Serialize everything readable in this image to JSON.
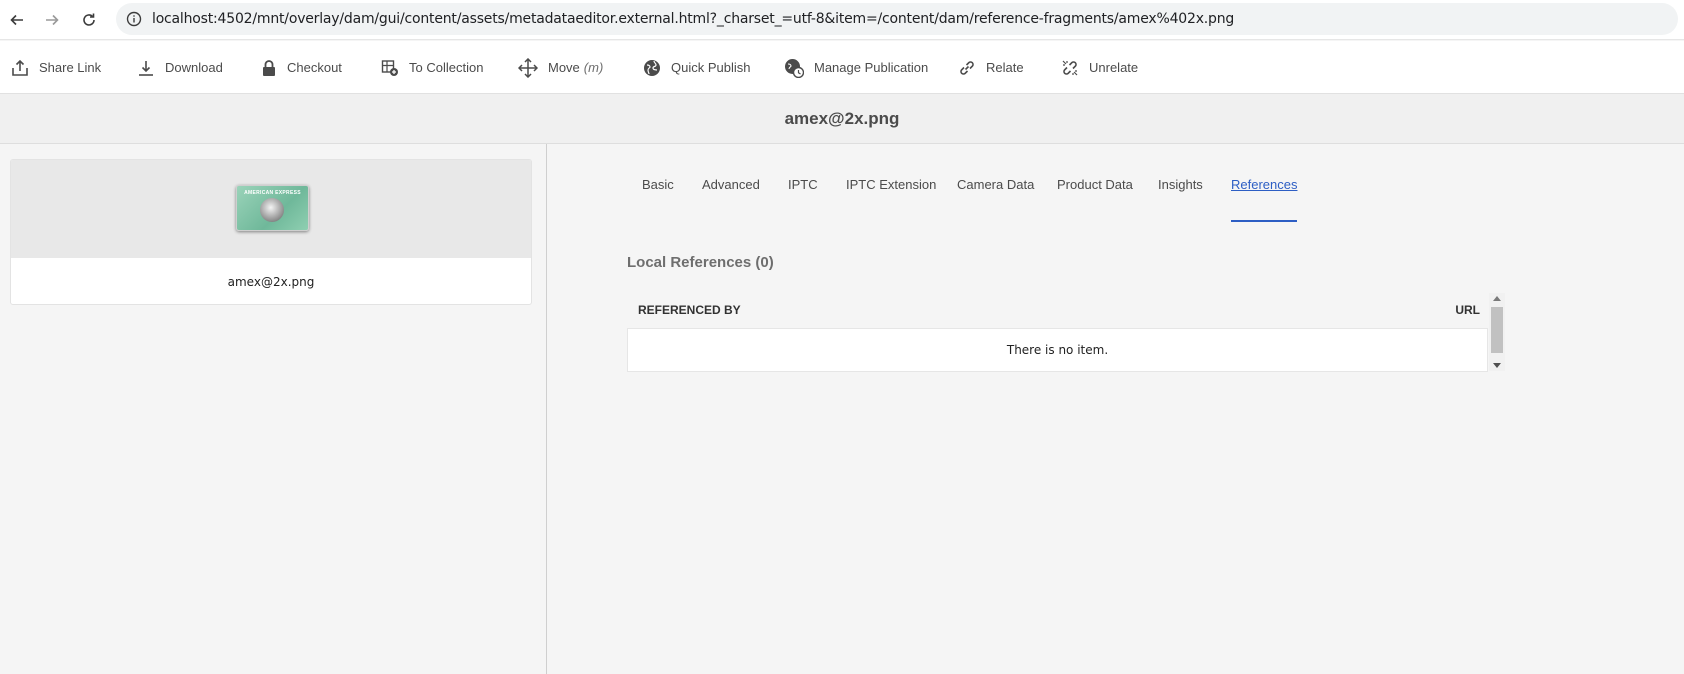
{
  "browser": {
    "url": "localhost:4502/mnt/overlay/dam/gui/content/assets/metadataeditor.external.html?_charset_=utf-8&item=/content/dam/reference-fragments/amex%402x.png"
  },
  "toolbar": {
    "share_link": "Share Link",
    "download": "Download",
    "checkout": "Checkout",
    "to_collection": "To Collection",
    "move": "Move",
    "move_shortcut": "(m)",
    "quick_publish": "Quick Publish",
    "manage_publication": "Manage Publication",
    "relate": "Relate",
    "unrelate": "Unrelate"
  },
  "header": {
    "title": "amex@2x.png"
  },
  "asset_card": {
    "filename": "amex@2x.png",
    "thumbnail_brand": "AMERICAN EXPRESS"
  },
  "tabs": [
    {
      "label": "Basic",
      "active": false
    },
    {
      "label": "Advanced",
      "active": false
    },
    {
      "label": "IPTC",
      "active": false
    },
    {
      "label": "IPTC Extension",
      "active": false
    },
    {
      "label": "Camera Data",
      "active": false
    },
    {
      "label": "Product Data",
      "active": false
    },
    {
      "label": "Insights",
      "active": false
    },
    {
      "label": "References",
      "active": true
    }
  ],
  "references": {
    "section_title": "Local References (0)",
    "columns": {
      "referenced_by": "REFERENCED BY",
      "url": "URL"
    },
    "empty_message": "There is no item."
  },
  "colors": {
    "accent": "#2d5ec4",
    "text": "#4b4b4b",
    "panel_bg": "#f5f5f5"
  },
  "icons": {
    "back": "arrow-left-icon",
    "forward": "arrow-right-icon",
    "reload": "reload-icon",
    "site_info": "info-icon",
    "share_link": "share-icon",
    "download": "download-icon",
    "checkout": "lock-icon",
    "to_collection": "collection-add-icon",
    "move": "move-icon",
    "quick_publish": "globe-icon",
    "manage_publication": "globe-clock-icon",
    "relate": "link-icon",
    "unrelate": "unlink-icon"
  }
}
